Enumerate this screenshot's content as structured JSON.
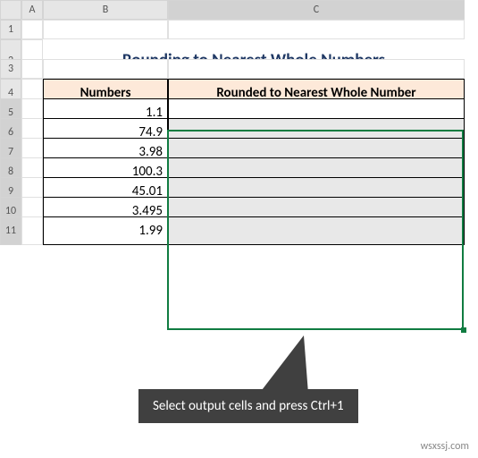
{
  "columns": [
    "A",
    "B",
    "C"
  ],
  "rows": [
    "1",
    "2",
    "3",
    "4",
    "5",
    "6",
    "7",
    "8",
    "9",
    "10",
    "11"
  ],
  "title": "Rounding to Nearest Whole Numbers",
  "headers": {
    "numbers": "Numbers",
    "rounded": "Rounded to Nearest Whole Number"
  },
  "data": {
    "numbers": [
      "1.1",
      "74.9",
      "3.98",
      "100.3",
      "45.01",
      "3.495",
      "1.99"
    ]
  },
  "callout": "Select output cells and press Ctrl+1",
  "watermark": "wsxssj.com"
}
